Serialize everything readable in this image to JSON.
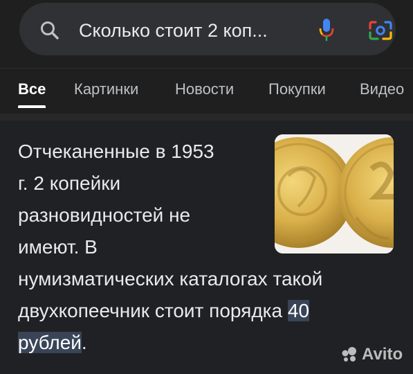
{
  "search": {
    "query": "Сколько стоит 2 коп..."
  },
  "tabs": [
    {
      "label": "Все"
    },
    {
      "label": "Картинки"
    },
    {
      "label": "Новости"
    },
    {
      "label": "Покупки"
    },
    {
      "label": "Видео"
    }
  ],
  "answer": {
    "lines": [
      "Отчеканенные в 1953",
      "г. 2 копейки",
      "разновидностей не",
      "имеют. В",
      "нумизматических каталогах такой",
      "двухкопеечник стоит порядка "
    ],
    "highlight_1": "40",
    "highlight_2": "рублей",
    "tail": "."
  },
  "watermark": {
    "text": "Avito"
  },
  "colors": {
    "background": "#202124",
    "search_bg": "#303134",
    "highlight": "#394457",
    "google_blue": "#4285F4",
    "google_red": "#EA4335",
    "google_yellow": "#FBBC05",
    "google_green": "#34A853"
  },
  "icons": [
    "search-icon",
    "mic-icon",
    "google-lens-icon",
    "avito-logo-icon"
  ]
}
